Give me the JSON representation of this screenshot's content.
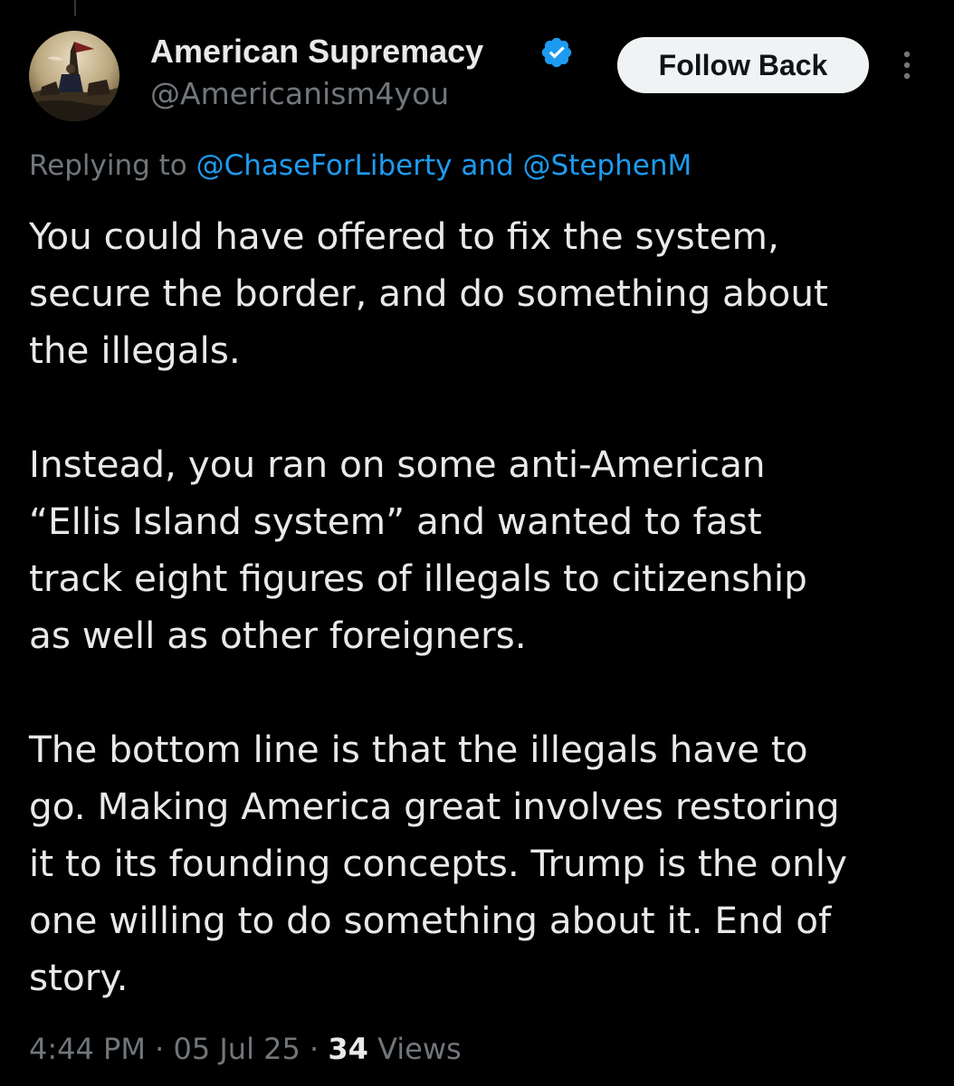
{
  "colors": {
    "background": "#000000",
    "text_primary": "#e7e9ea",
    "text_secondary": "#71767b",
    "accent_link": "#1d9bf0",
    "verified_badge": "#1d9bf0",
    "button_bg": "#eff3f4",
    "button_text": "#0f1419"
  },
  "icons": {
    "verified": "verified-badge-icon",
    "more": "more-vertical-icon"
  },
  "author": {
    "display_name": "American Supremacy",
    "handle": "@Americanism4you",
    "verified": true
  },
  "follow_button": {
    "label": "Follow Back"
  },
  "reply_context": {
    "prefix": "Replying to",
    "mention_1": "@ChaseForLiberty",
    "conjunction": "and",
    "mention_2": "@StephenM"
  },
  "tweet": {
    "paragraphs": [
      "You could have offered to fix the system,\nsecure the border, and do something about\nthe illegals.",
      "Instead, you ran on some anti-American\n“Ellis Island system” and wanted to fast\ntrack eight figures of illegals to citizenship\nas well as other foreigners.",
      "The bottom line is that the illegals have to\ngo. Making America great involves restoring\nit to its founding concepts. Trump is the only\none willing to do something about it. End of\nstory."
    ]
  },
  "meta": {
    "time": "4:44 PM",
    "separator": "·",
    "date": "05 Jul 25",
    "views_count": "34",
    "views_label": "Views"
  }
}
